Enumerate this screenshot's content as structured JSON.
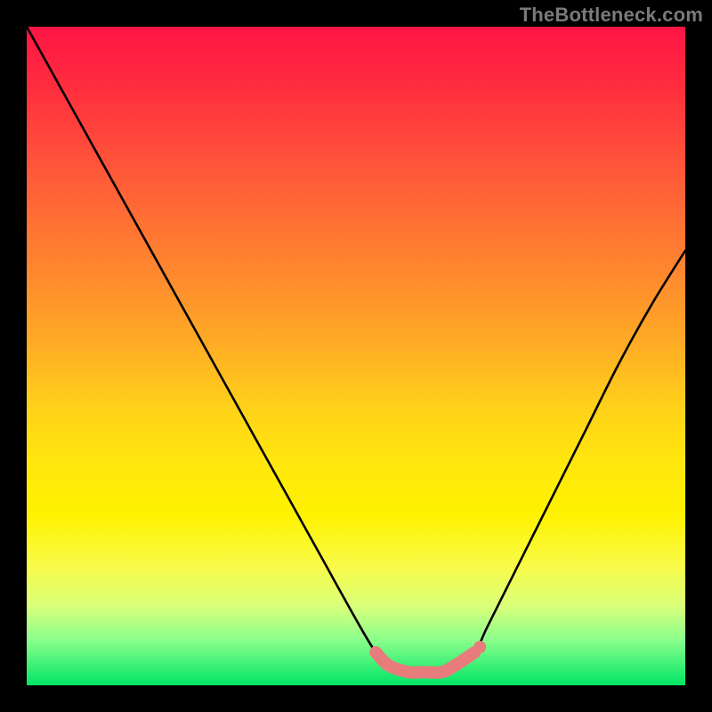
{
  "watermark": "TheBottleneck.com",
  "chart_data": {
    "type": "line",
    "title": "",
    "xlabel": "",
    "ylabel": "",
    "xlim": [
      0,
      100
    ],
    "ylim": [
      0,
      100
    ],
    "series": [
      {
        "name": "bottleneck-curve",
        "x": [
          0,
          5,
          10,
          15,
          20,
          25,
          30,
          35,
          40,
          45,
          50,
          53,
          55,
          58,
          60,
          63,
          65,
          68,
          70,
          75,
          80,
          85,
          90,
          95,
          100
        ],
        "y": [
          100,
          91,
          82,
          73,
          64,
          55,
          46,
          37,
          28,
          19,
          10,
          5,
          3,
          2,
          2,
          2,
          3,
          5,
          9,
          19,
          29,
          39,
          49,
          58,
          66
        ]
      },
      {
        "name": "highlight-band",
        "x": [
          53,
          55,
          58,
          60,
          63,
          65,
          68
        ],
        "y": [
          5,
          3,
          2,
          2,
          2,
          3,
          5
        ]
      }
    ],
    "annotations": []
  }
}
